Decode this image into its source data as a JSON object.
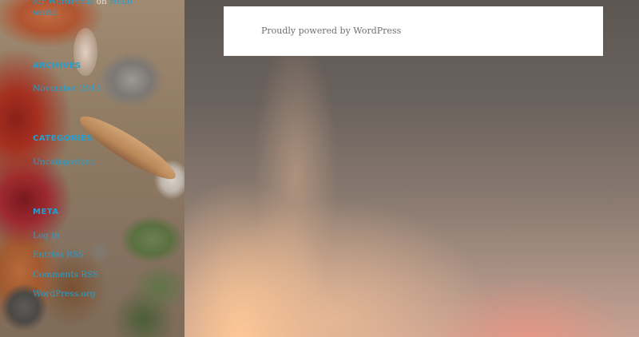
{
  "sidebar": {
    "recent_comments": {
      "author": "Mr WordPress",
      "connector": "on",
      "post_line1": "Hello",
      "post_line2": "world!"
    },
    "archives": {
      "heading": "ARCHIVES",
      "items": [
        "November 2015"
      ]
    },
    "categories": {
      "heading": "CATEGORIES",
      "items": [
        "Uncategorized"
      ]
    },
    "meta": {
      "heading": "META",
      "items": [
        "Log in",
        "Entries RSS",
        "Comments RSS",
        "WordPress.org"
      ]
    }
  },
  "footer": {
    "credit": "Proudly powered by WordPress"
  },
  "colors": {
    "link": "#21a0d2",
    "footer_text": "#707070",
    "card_background": "#ffffff"
  }
}
